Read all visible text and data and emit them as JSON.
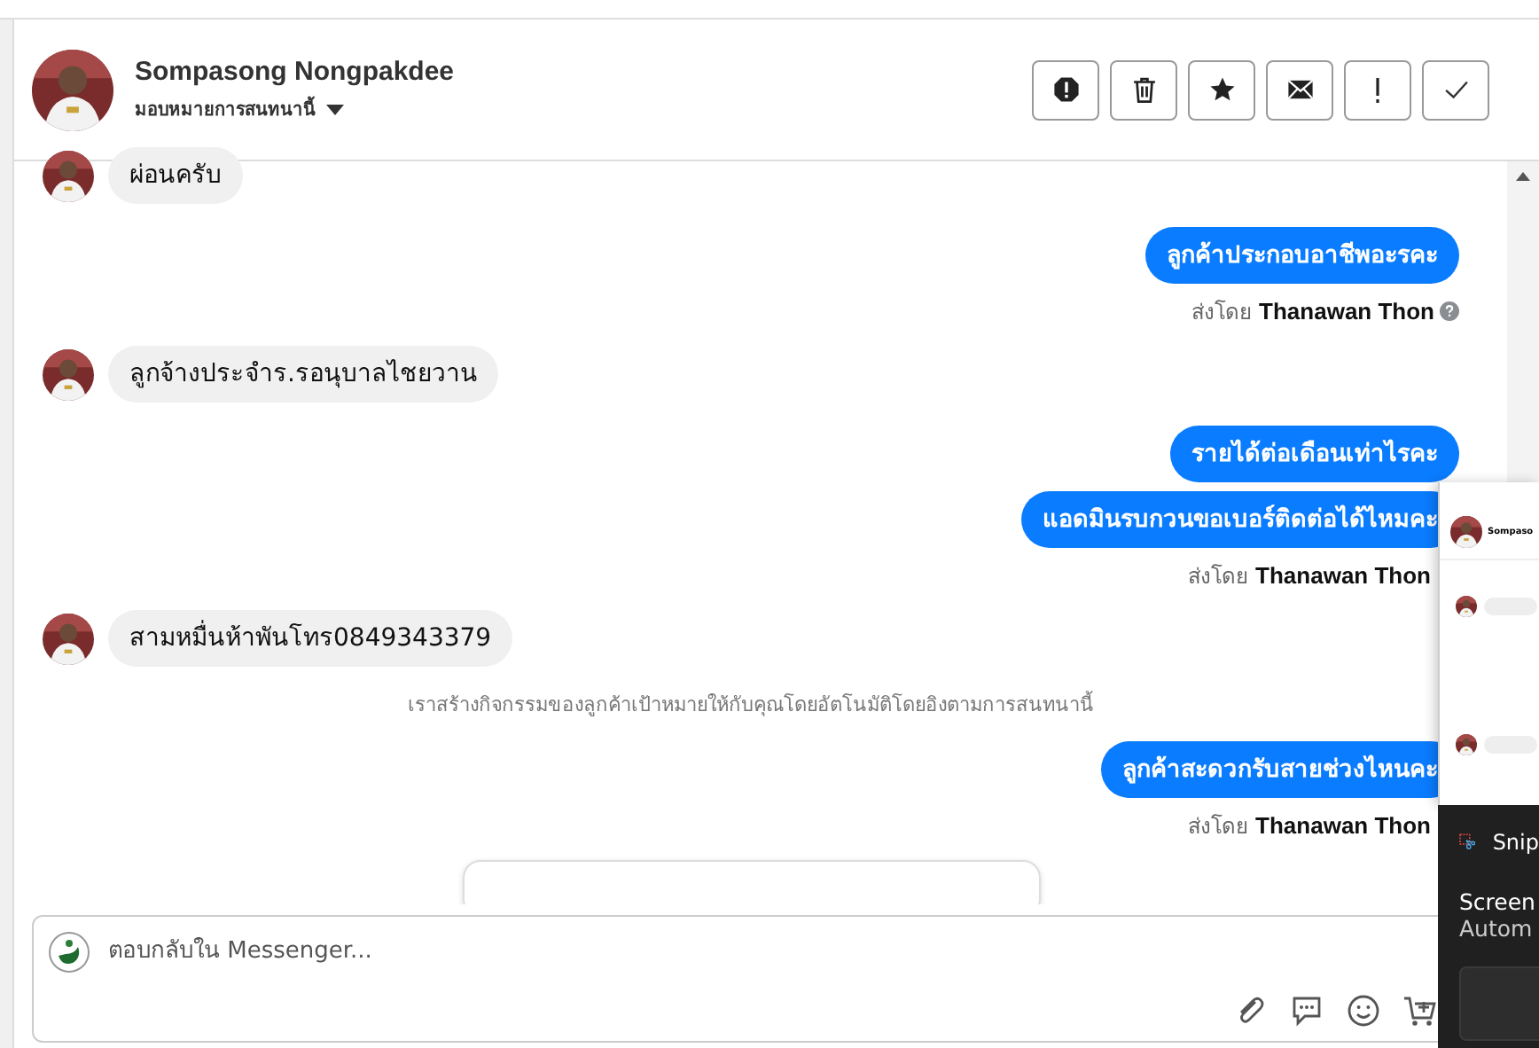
{
  "header": {
    "name": "Sompasong Nongpakdee",
    "subtitle": "มอบหมายการสนทนานี้",
    "actions": [
      {
        "kind": "report"
      },
      {
        "kind": "delete"
      },
      {
        "kind": "star"
      },
      {
        "kind": "mail"
      },
      {
        "kind": "alert"
      },
      {
        "kind": "done"
      }
    ]
  },
  "messages": [
    {
      "kind": "incoming",
      "text": "ผ่อนครับ"
    },
    {
      "kind": "outgoing",
      "text": "ลูกค้าประกอบอาชีพอะรคะ"
    },
    {
      "kind": "note",
      "prefix": "ส่งโดย",
      "sender": "Thanawan Thon",
      "help_icon": true
    },
    {
      "kind": "incoming",
      "text": "ลูกจ้างประจำร.รอนุบาลไชยวาน"
    },
    {
      "kind": "outgoing",
      "text": "รายได้ต่อเดือนเท่าไรคะ"
    },
    {
      "kind": "outgoing",
      "text": "แอดมินรบกวนขอเบอร์ติดต่อได้ไหมคะ"
    },
    {
      "kind": "note",
      "prefix": "ส่งโดย",
      "sender": "Thanawan Thon"
    },
    {
      "kind": "incoming",
      "text": "สามหมื่นห้าพันโทร0849343379"
    },
    {
      "kind": "system",
      "text": "เราสร้างกิจกรรมของลูกค้าเป้าหมายให้กับคุณโดยอัตโนมัติโดยอิงตามการสนทนานี้"
    },
    {
      "kind": "outgoing",
      "text": "ลูกค้าสะดวกรับสายช่วงไหนคะ"
    },
    {
      "kind": "note",
      "prefix": "ส่งโดย",
      "sender": "Thanawan Thon"
    },
    {
      "kind": "card"
    }
  ],
  "composer": {
    "placeholder": "ตอบกลับใน Messenger...",
    "tools": [
      {
        "kind": "attach"
      },
      {
        "kind": "reply"
      },
      {
        "kind": "emoji"
      },
      {
        "kind": "cart"
      }
    ]
  },
  "overlay": {
    "preview_title": "Sompaso",
    "app": "Snip",
    "heading": "Screen",
    "body": "Autom"
  }
}
